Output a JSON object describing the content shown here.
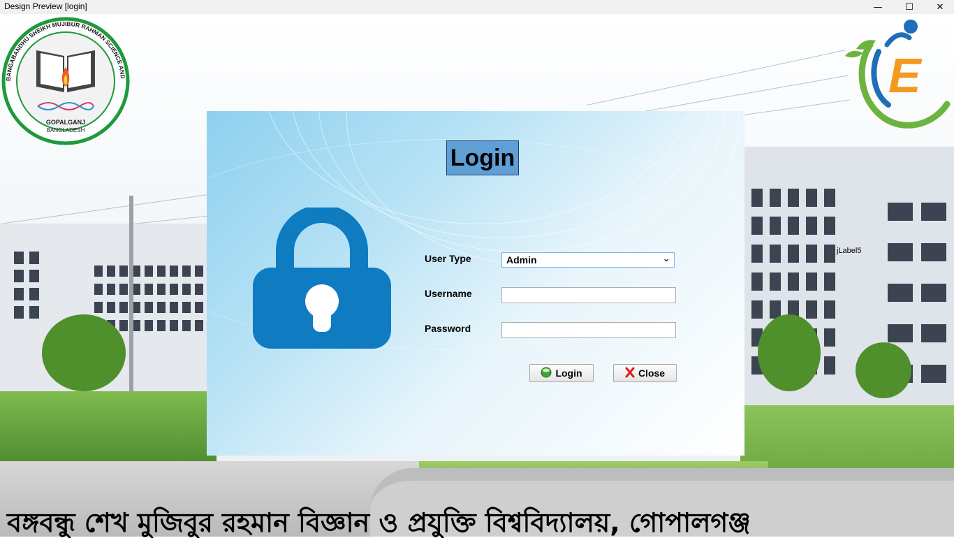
{
  "window": {
    "title": "Design Preview [login]",
    "minimize_glyph": "—",
    "maximize_glyph": "☐",
    "close_glyph": "✕"
  },
  "logo_university": {
    "ring_text": "BANGABANDHU SHEIKH MUJIBUR RAHMAN SCIENCE AND TECHNOLOGY UNIVERSITY",
    "city": "GOPALGANJ",
    "country": "BANGLADESH"
  },
  "logo_e": {
    "letter": "E"
  },
  "jlabel": "jLabel5",
  "login": {
    "title": "Login",
    "user_type_label": "User Type",
    "user_type_value": "Admin",
    "username_label": "Username",
    "username_value": "",
    "password_label": "Password",
    "password_value": "",
    "login_button": "Login",
    "close_button": "Close"
  },
  "banner": "বঙ্গবন্ধু শেখ মুজিবুর রহমান বিজ্ঞান ও প্রযুক্তি বিশ্ববিদ্যালয়, গোপালগঞ্জ",
  "colors": {
    "lock": "#0f7bc1",
    "title_bg": "#5f9fd6",
    "logo_green": "#1e9a3a",
    "e_orange": "#f39a1e"
  }
}
